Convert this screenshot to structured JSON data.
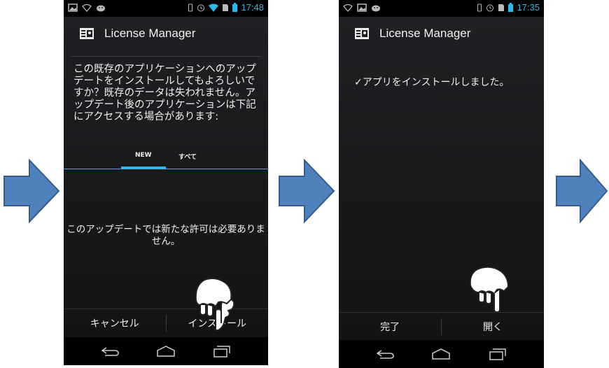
{
  "screen1": {
    "status_time": "17:48",
    "app_title": "License Manager",
    "question_text": "この既存のアプリケーションへのアップデートをインストールしてもよろしいですか？既存のデータは失われません。アップデート後のアプリケーションは下記にアクセスする場合があります:",
    "tab_new": "NEW",
    "tab_all": "すべて",
    "no_permission_text": "このアップデートでは新たな許可は必要ありません。",
    "cancel_label": "キャンセル",
    "install_label": "インストール"
  },
  "screen2": {
    "status_time": "17:35",
    "app_title": "License Manager",
    "installed_text": "✓アプリをインストールしました。",
    "done_label": "完了",
    "open_label": "開く"
  },
  "colors": {
    "accent": "#33b5e5",
    "arrow_fill": "#4f81bd",
    "arrow_stroke": "#385d8a"
  },
  "icons": [
    "picture-icon",
    "wifi-question-icon",
    "android-icon",
    "vibrate-icon",
    "alarm-icon",
    "wifi-icon",
    "sim-icon",
    "battery-icon",
    "license-card-icon",
    "back-icon",
    "home-icon",
    "recent-apps-icon",
    "pointing-hand-icon",
    "next-arrow-icon"
  ]
}
